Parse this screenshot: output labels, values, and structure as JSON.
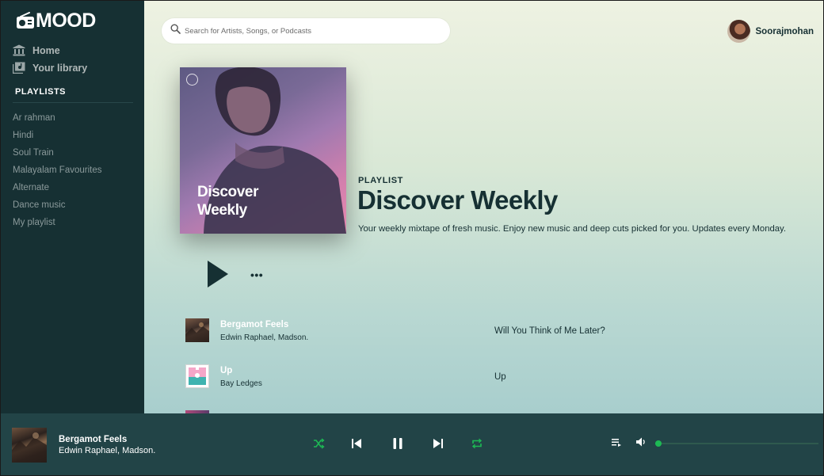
{
  "app": {
    "logo_text": "MOOD"
  },
  "sidebar": {
    "nav": [
      {
        "label": "Home",
        "icon": "home-icon"
      },
      {
        "label": "Your library",
        "icon": "library-icon"
      }
    ],
    "playlists_heading": "PLAYLISTS",
    "playlists": [
      "Ar rahman",
      "Hindi",
      "Soul Train",
      "Malayalam Favourites",
      "Alternate",
      "Dance music",
      "My playlist"
    ]
  },
  "header": {
    "search_placeholder": "Search for Artists, Songs, or Podcasts",
    "username": "Soorajmohan"
  },
  "playlist": {
    "cover_title": "Discover\nWeekly",
    "type_label": "PLAYLIST",
    "title": "Discover Weekly",
    "description": "Your weekly mixtape of fresh music. Enjoy new music and deep cuts picked for you. Updates every Monday.",
    "more_label": "•••"
  },
  "tracks": [
    {
      "name": "Bergamot Feels",
      "artist": "Edwin Raphael, Madson.",
      "album": "Will You Think of Me Later?"
    },
    {
      "name": "Up",
      "artist": "Bay Ledges",
      "album": "Up"
    }
  ],
  "player": {
    "title": "Bergamot Feels",
    "artist": "Edwin Raphael, Madson.",
    "volume": 0.02
  },
  "colors": {
    "sidebar_bg": "#163033",
    "player_bg": "#224447",
    "accent": "#1db954",
    "text_dark": "#163033"
  }
}
